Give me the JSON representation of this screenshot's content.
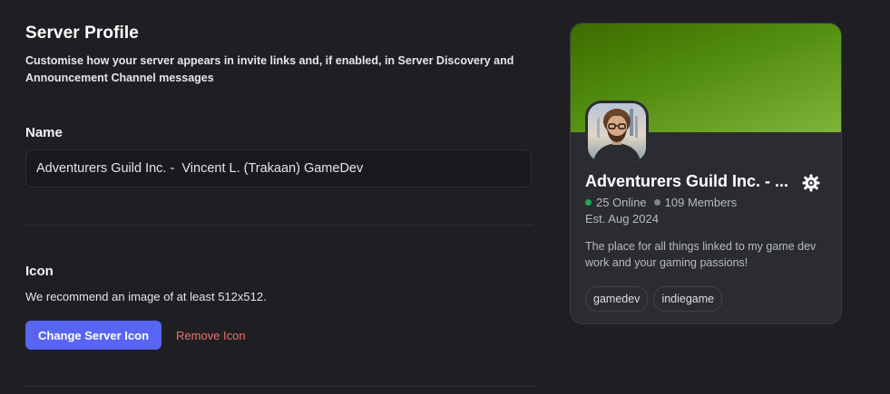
{
  "server_profile": {
    "title": "Server Profile",
    "subtitle": "Customise how your server appears in invite links and, if enabled, in Server Discovery and Announcement Channel messages",
    "name_section": {
      "label": "Name",
      "value": "Adventurers Guild Inc. -  Vincent L. (Trakaan) GameDev"
    },
    "icon_section": {
      "label": "Icon",
      "hint": "We recommend an image of at least 512x512.",
      "change_button": "Change Server Icon",
      "remove_button": "Remove Icon"
    }
  },
  "preview_card": {
    "server_name": "Adventurers Guild Inc. - ...",
    "online": "25 Online",
    "members": "109 Members",
    "established": "Est. Aug 2024",
    "description": "The place for all things linked to my game dev work and your gaming passions!",
    "tags": [
      "gamedev",
      "indiegame"
    ],
    "badge_icon": "community-gear-icon",
    "colors": {
      "banner": "#4f8a0c",
      "online_dot": "#23a55a",
      "members_dot": "#80848e"
    }
  },
  "colors": {
    "background": "#1f1f23",
    "primary_button": "#5865f2",
    "danger_link": "#f0706c"
  }
}
